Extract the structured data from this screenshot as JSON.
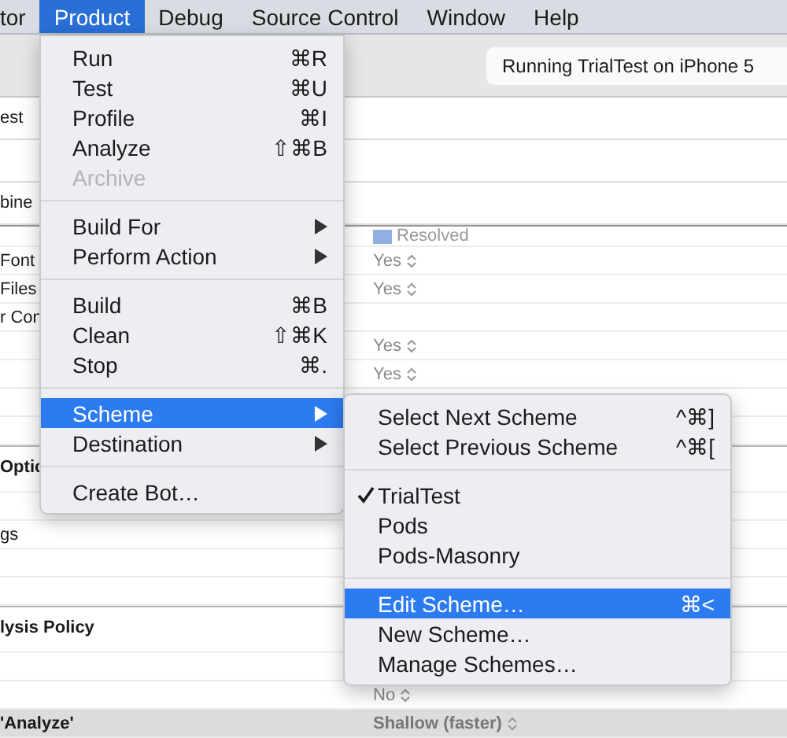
{
  "menu_bar": [
    {
      "label": "tor",
      "selected": false
    },
    {
      "label": "Product",
      "selected": true
    },
    {
      "label": "Debug",
      "selected": false
    },
    {
      "label": "Source Control",
      "selected": false
    },
    {
      "label": "Window",
      "selected": false
    },
    {
      "label": "Help",
      "selected": false
    }
  ],
  "activity_status": "Running TrialTest on iPhone 5",
  "settings_rows": [
    {
      "kind": "tall",
      "label": "est"
    },
    {
      "kind": "tall"
    },
    {
      "kind": "tall",
      "label": "bine"
    },
    {
      "kind": "column-header",
      "value": "Resolved"
    },
    {
      "kind": "row",
      "label": "Font",
      "value": "Yes"
    },
    {
      "kind": "row",
      "label": "Files",
      "value": "Yes"
    },
    {
      "kind": "row",
      "label": "r Con"
    },
    {
      "kind": "row",
      "value": "Yes"
    },
    {
      "kind": "row",
      "value": "Yes"
    },
    {
      "kind": "row"
    },
    {
      "kind": "row"
    },
    {
      "kind": "header",
      "label": "Optic"
    },
    {
      "kind": "row"
    },
    {
      "kind": "row",
      "label": "gs"
    },
    {
      "kind": "row"
    },
    {
      "kind": "row"
    },
    {
      "kind": "header",
      "label": "lysis Policy"
    },
    {
      "kind": "row"
    },
    {
      "kind": "row",
      "value": "No"
    },
    {
      "kind": "highlight",
      "label": "'Analyze'",
      "value": "Shallow (faster)"
    }
  ],
  "product_menu": [
    {
      "kind": "item",
      "label": "Run",
      "shortcut": "⌘R",
      "disabled": false,
      "selected": false,
      "submenu": false
    },
    {
      "kind": "item",
      "label": "Test",
      "shortcut": "⌘U",
      "disabled": false,
      "selected": false,
      "submenu": false
    },
    {
      "kind": "item",
      "label": "Profile",
      "shortcut": "⌘I",
      "disabled": false,
      "selected": false,
      "submenu": false
    },
    {
      "kind": "item",
      "label": "Analyze",
      "shortcut": "⇧⌘B",
      "disabled": false,
      "selected": false,
      "submenu": false
    },
    {
      "kind": "item",
      "label": "Archive",
      "disabled": true,
      "selected": false,
      "submenu": false
    },
    {
      "kind": "separator"
    },
    {
      "kind": "item",
      "label": "Build For",
      "disabled": false,
      "selected": false,
      "submenu": true
    },
    {
      "kind": "item",
      "label": "Perform Action",
      "disabled": false,
      "selected": false,
      "submenu": true
    },
    {
      "kind": "separator"
    },
    {
      "kind": "item",
      "label": "Build",
      "shortcut": "⌘B",
      "disabled": false,
      "selected": false,
      "submenu": false
    },
    {
      "kind": "item",
      "label": "Clean",
      "shortcut": "⇧⌘K",
      "disabled": false,
      "selected": false,
      "submenu": false
    },
    {
      "kind": "item",
      "label": "Stop",
      "shortcut": "⌘.",
      "disabled": false,
      "selected": false,
      "submenu": false
    },
    {
      "kind": "separator"
    },
    {
      "kind": "item",
      "label": "Scheme",
      "disabled": false,
      "selected": true,
      "submenu": true
    },
    {
      "kind": "item",
      "label": "Destination",
      "disabled": false,
      "selected": false,
      "submenu": true
    },
    {
      "kind": "separator"
    },
    {
      "kind": "item",
      "label": "Create Bot…",
      "disabled": false,
      "selected": false,
      "submenu": false
    }
  ],
  "scheme_submenu": [
    {
      "kind": "item",
      "label": "Select Next Scheme",
      "shortcut": "^⌘]",
      "checked": false,
      "selected": false
    },
    {
      "kind": "item",
      "label": "Select Previous Scheme",
      "shortcut": "^⌘[",
      "checked": false,
      "selected": false
    },
    {
      "kind": "separator"
    },
    {
      "kind": "item",
      "label": "TrialTest",
      "checked": true,
      "selected": false
    },
    {
      "kind": "item",
      "label": "Pods",
      "checked": false,
      "selected": false
    },
    {
      "kind": "item",
      "label": "Pods-Masonry",
      "checked": false,
      "selected": false
    },
    {
      "kind": "separator"
    },
    {
      "kind": "item",
      "label": "Edit Scheme…",
      "shortcut": "⌘<",
      "checked": false,
      "selected": true
    },
    {
      "kind": "item",
      "label": "New Scheme…",
      "checked": false,
      "selected": false
    },
    {
      "kind": "item",
      "label": "Manage Schemes…",
      "checked": false,
      "selected": false
    }
  ]
}
